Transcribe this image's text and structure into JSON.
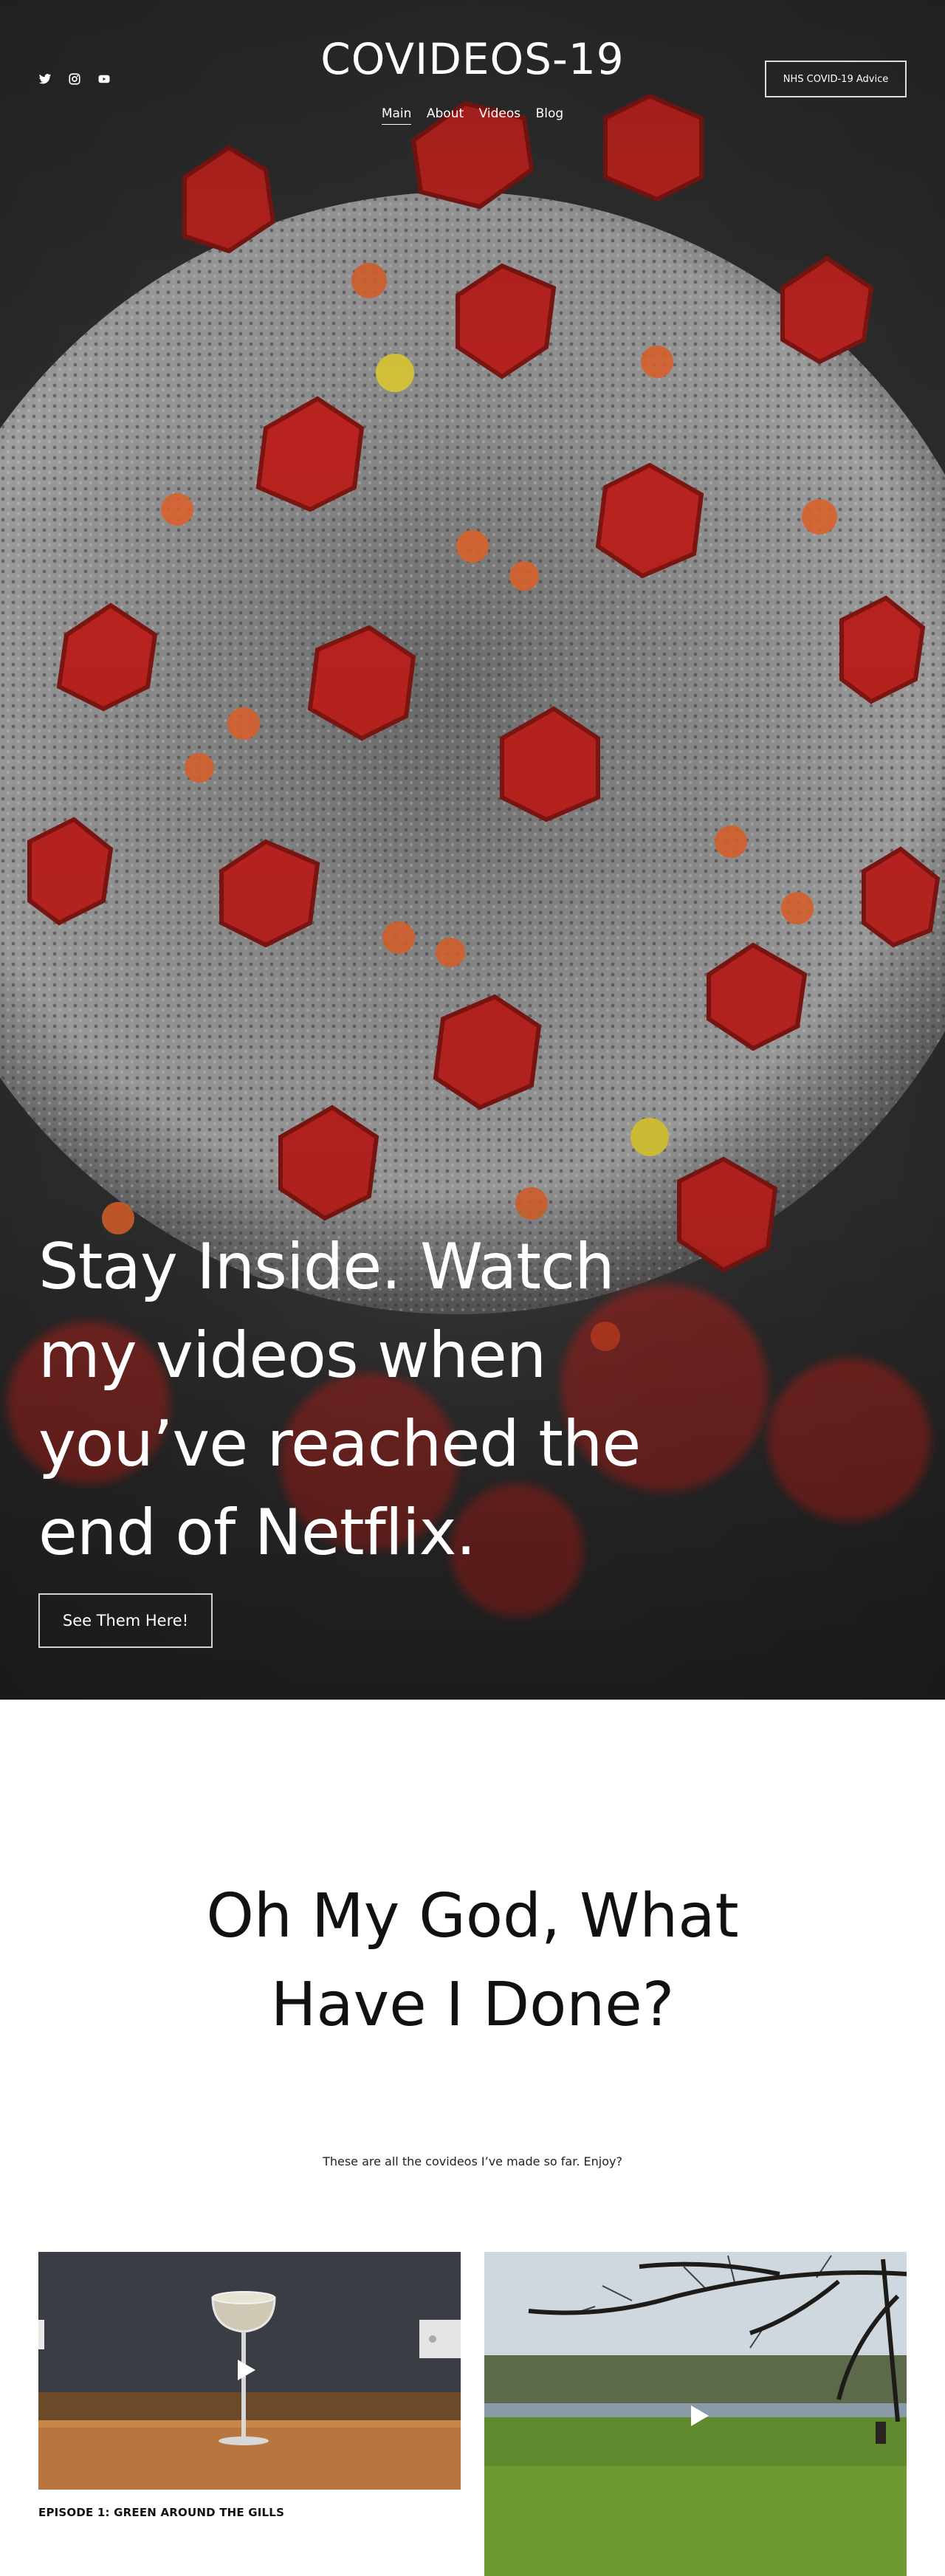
{
  "header": {
    "site_title": "COVIDEOS-19",
    "nav": [
      {
        "label": "Main",
        "active": true
      },
      {
        "label": "About",
        "active": false
      },
      {
        "label": "Videos",
        "active": false
      },
      {
        "label": "Blog",
        "active": false
      }
    ],
    "nhs_button": "NHS COVID-19 Advice",
    "social_icons": [
      "twitter-icon",
      "instagram-icon",
      "youtube-icon"
    ]
  },
  "hero": {
    "heading": "Stay Inside. Watch my videos when you’ve reached the end of Netflix.",
    "cta_label": "See Them Here!"
  },
  "videos_section": {
    "heading": "Oh My God, What Have I Done?",
    "subtitle": "These are all the covideos I’ve made so far. Enjoy?",
    "cards": [
      {
        "caption": "EPISODE 1: GREEN AROUND THE GILLS"
      },
      {
        "caption": ""
      }
    ]
  }
}
